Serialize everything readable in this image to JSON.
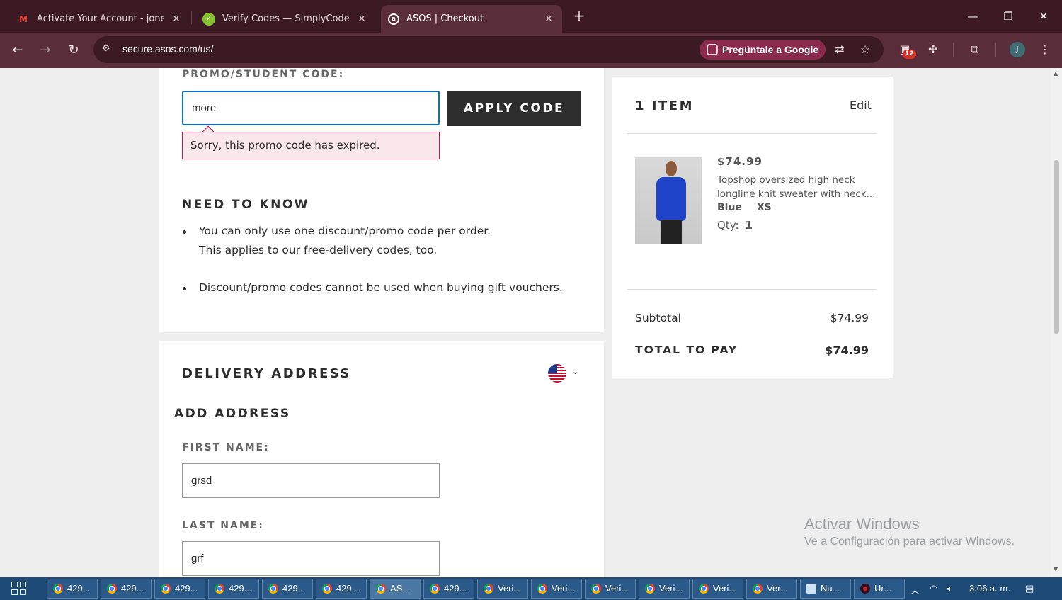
{
  "browser": {
    "tabs": [
      {
        "title": "Activate Your Account - jonespa",
        "icon": "gmail-icon",
        "active": false
      },
      {
        "title": "Verify Codes — SimplyCodes",
        "icon": "simplycodes-icon",
        "active": false
      },
      {
        "title": "ASOS | Checkout",
        "icon": "asos-icon",
        "active": true
      }
    ],
    "url": "secure.asos.com/us/",
    "ask_google": "Pregúntale a Google",
    "extension_badge": "12",
    "profile_initial": "J"
  },
  "promo": {
    "label": "PROMO/STUDENT CODE:",
    "input_value": "more",
    "apply_button": "APPLY CODE",
    "error": "Sorry, this promo code has expired."
  },
  "need_to_know": {
    "title": "NEED TO KNOW",
    "items": [
      {
        "line1": "You can only use one discount/promo code per order.",
        "line2": "This applies to our free-delivery codes, too."
      },
      {
        "line1": "Discount/promo codes cannot be used when buying gift vouchers."
      }
    ]
  },
  "delivery": {
    "title": "DELIVERY ADDRESS",
    "country_flag": "us-flag-icon",
    "add_address": "ADD ADDRESS",
    "first_name_label": "FIRST NAME:",
    "first_name_value": "grsd",
    "last_name_label": "LAST NAME:",
    "last_name_value": "grf"
  },
  "summary": {
    "items_title": "1 ITEM",
    "edit": "Edit",
    "product": {
      "price": "$74.99",
      "name_line1": "Topshop oversized high neck",
      "name_line2": "longline knit sweater with neck...",
      "color": "Blue",
      "size": "XS",
      "qty_label": "Qty:",
      "qty_value": "1"
    },
    "subtotal_label": "Subtotal",
    "subtotal_value": "$74.99",
    "total_label": "TOTAL TO PAY",
    "total_value": "$74.99"
  },
  "watermark": {
    "line1": "Activar Windows",
    "line2": "Ve a Configuración para activar Windows."
  },
  "taskbar": {
    "apps": [
      {
        "label": "429...",
        "icon": "chrome"
      },
      {
        "label": "429...",
        "icon": "chrome"
      },
      {
        "label": "429...",
        "icon": "chrome"
      },
      {
        "label": "429...",
        "icon": "chrome"
      },
      {
        "label": "429...",
        "icon": "chrome"
      },
      {
        "label": "429...",
        "icon": "chrome"
      },
      {
        "label": "AS...",
        "icon": "chrome",
        "active": true
      },
      {
        "label": "429...",
        "icon": "chrome"
      },
      {
        "label": "Veri...",
        "icon": "chrome"
      },
      {
        "label": "Veri...",
        "icon": "chrome"
      },
      {
        "label": "Veri...",
        "icon": "chrome"
      },
      {
        "label": "Veri...",
        "icon": "chrome"
      },
      {
        "label": "Veri...",
        "icon": "chrome"
      },
      {
        "label": "Ver...",
        "icon": "chrome"
      },
      {
        "label": "Nu...",
        "icon": "notepad"
      },
      {
        "label": "Ur...",
        "icon": "app"
      }
    ],
    "clock": "3:06 a. m."
  }
}
